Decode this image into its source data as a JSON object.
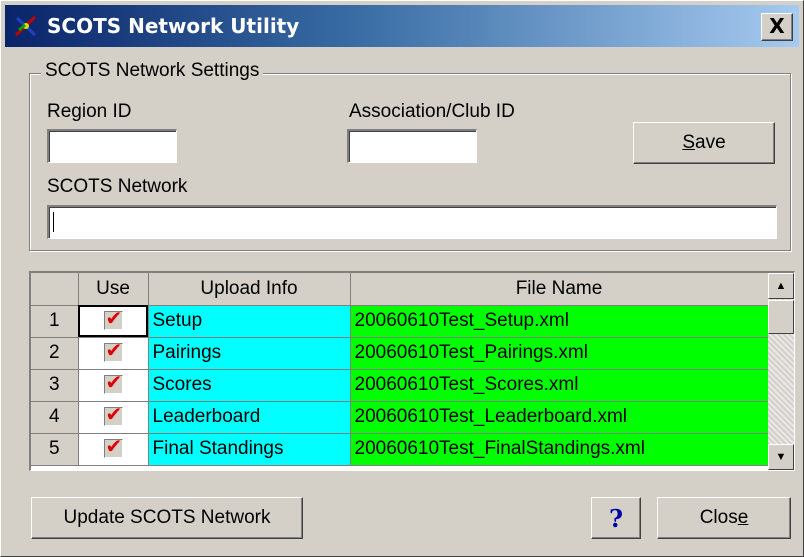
{
  "window": {
    "title": "SCOTS Network Utility",
    "close_glyph": "X",
    "icon": "scots-app-icon"
  },
  "settings": {
    "group_title": "SCOTS Network Settings",
    "region_label": "Region ID",
    "region_value": "",
    "assoc_label": "Association/Club ID",
    "assoc_value": "",
    "network_label": "SCOTS Network",
    "network_value": "",
    "save_prefix": "",
    "save_accel": "S",
    "save_rest": "ave"
  },
  "grid": {
    "headers": {
      "row": "",
      "use": "Use",
      "info": "Upload Info",
      "file": "File Name"
    },
    "rows": [
      {
        "num": "1",
        "use": true,
        "info": "Setup",
        "file": "20060610Test_Setup.xml"
      },
      {
        "num": "2",
        "use": true,
        "info": "Pairings",
        "file": "20060610Test_Pairings.xml"
      },
      {
        "num": "3",
        "use": true,
        "info": "Scores",
        "file": "20060610Test_Scores.xml"
      },
      {
        "num": "4",
        "use": true,
        "info": "Leaderboard",
        "file": "20060610Test_Leaderboard.xml"
      },
      {
        "num": "5",
        "use": true,
        "info": "Final Standings",
        "file": "20060610Test_FinalStandings.xml"
      }
    ],
    "check_glyph": "✔",
    "scroll_up_glyph": "▲",
    "scroll_down_glyph": "▼"
  },
  "footer": {
    "update_label": "Update SCOTS Network",
    "help_label": "?",
    "close_prefix": "Clos",
    "close_accel": "e",
    "close_rest": ""
  },
  "colors": {
    "info_cell": "#00ffff",
    "file_cell": "#00ff00",
    "check_mark": "#e00000",
    "title_bar": "#0a246a"
  }
}
